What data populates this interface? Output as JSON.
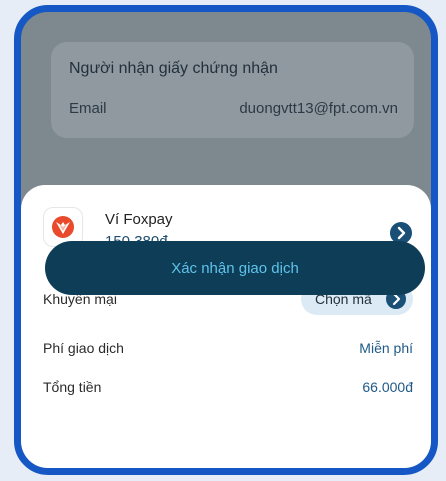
{
  "recipient": {
    "title": "Người nhận giấy chứng nhận",
    "email_label": "Email",
    "email_value": "duongvtt13@fpt.com.vn"
  },
  "payment": {
    "wallet_name": "Ví Foxpay",
    "wallet_balance": "150.380đ",
    "wallet_icon": "foxpay-logo",
    "promo_label": "Khuyến mại",
    "promo_button": "Chọn mã",
    "fee_label": "Phí giao dịch",
    "fee_value": "Miễn phí",
    "total_label": "Tổng tiền",
    "total_value": "66.000đ",
    "confirm_button": "Xác nhận giao dịch"
  },
  "colors": {
    "frame_border": "#1557c4",
    "accent": "#0e3d57",
    "link": "#1f5a86"
  }
}
